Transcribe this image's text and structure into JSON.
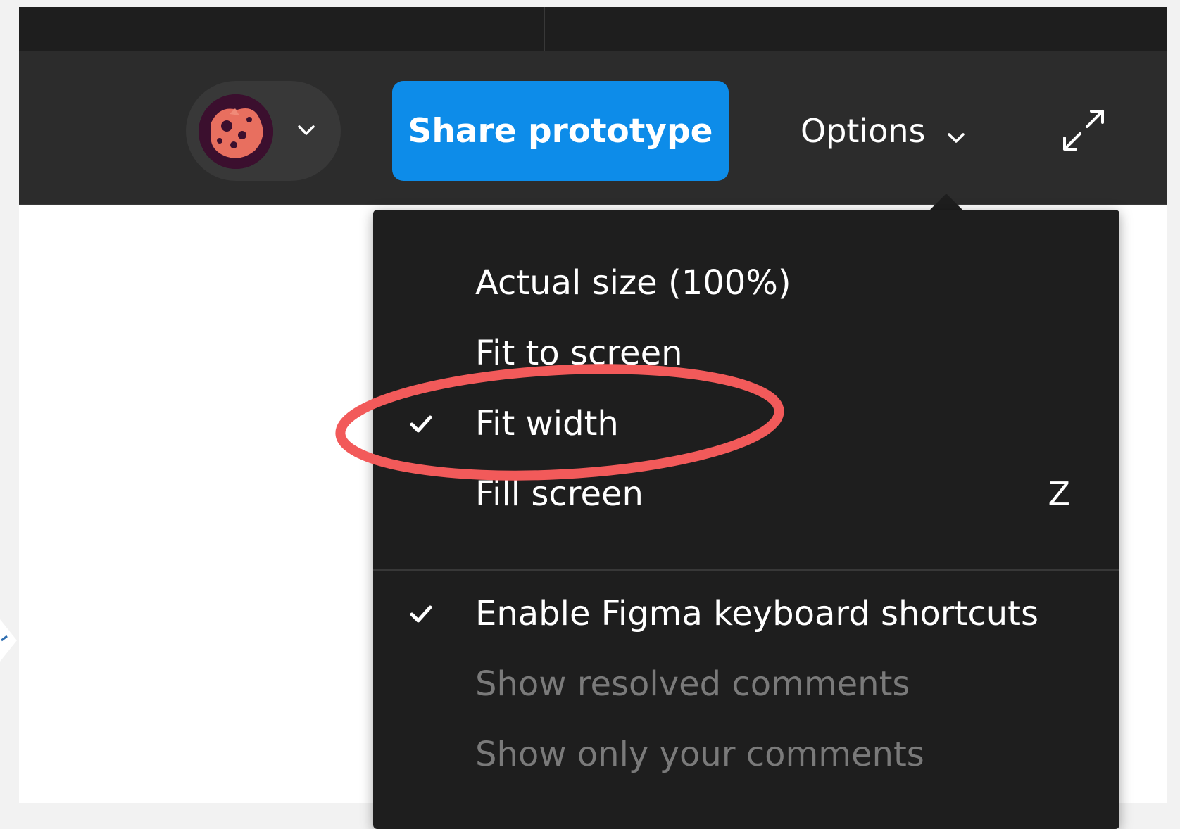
{
  "toolbar": {
    "share_label": "Share prototype",
    "options_label": "Options"
  },
  "icons": {
    "user_chevron": "chevron-down-icon",
    "options_chevron": "chevron-down-icon",
    "expand": "expand-arrows-icon",
    "check": "checkmark-icon"
  },
  "menu": {
    "zoom_items": [
      {
        "label": "Actual size (100%)",
        "checked": false,
        "shortcut": ""
      },
      {
        "label": "Fit to screen",
        "checked": false,
        "shortcut": ""
      },
      {
        "label": "Fit width",
        "checked": true,
        "shortcut": ""
      },
      {
        "label": "Fill screen",
        "checked": false,
        "shortcut": "Z"
      }
    ],
    "option_items": [
      {
        "label": "Enable Figma keyboard shortcuts",
        "checked": true,
        "enabled": true
      },
      {
        "label": "Show resolved comments",
        "checked": false,
        "enabled": false
      },
      {
        "label": "Show only your comments",
        "checked": false,
        "enabled": false
      }
    ]
  },
  "colors": {
    "titlebar": "#1e1e1e",
    "toolbar": "#2c2c2c",
    "accent_blue": "#0d8ce9",
    "menu_bg": "#1e1e1e",
    "disabled_text": "#7a7a7a",
    "annotation_red": "#f25a5a"
  }
}
